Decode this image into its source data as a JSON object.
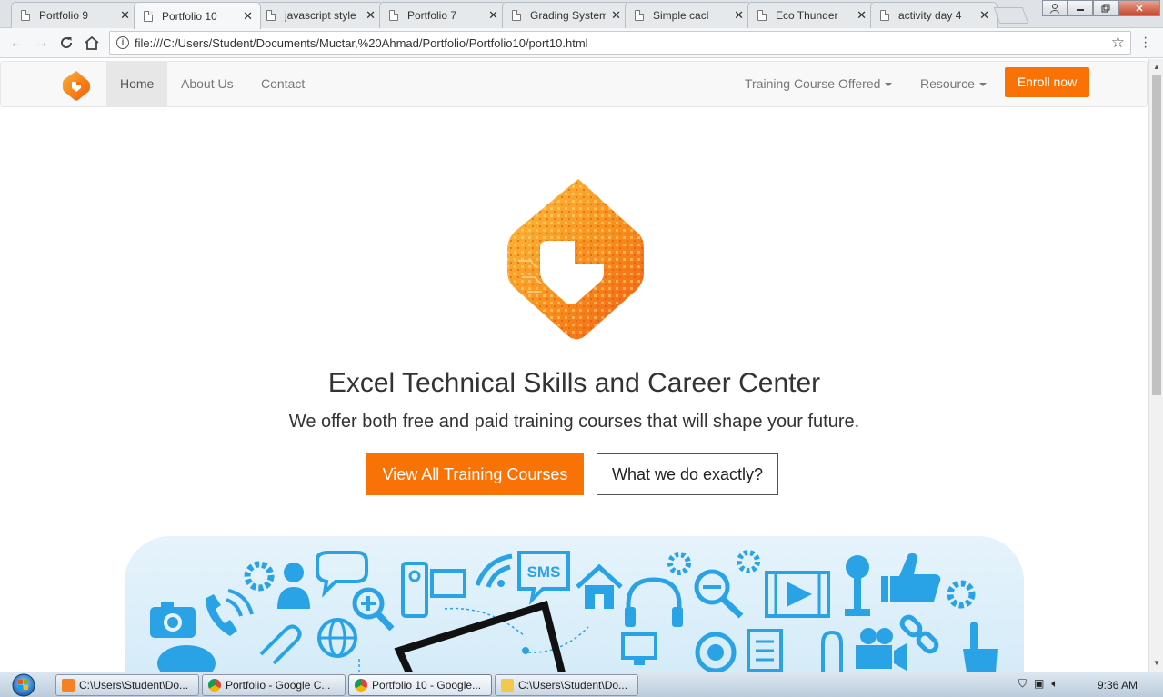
{
  "browser": {
    "tabs": [
      {
        "title": "Portfolio 9",
        "active": false
      },
      {
        "title": "Portfolio 10",
        "active": true
      },
      {
        "title": "javascript style",
        "active": false
      },
      {
        "title": "Portfolio 7",
        "active": false
      },
      {
        "title": "Grading System",
        "active": false
      },
      {
        "title": "Simple cacl",
        "active": false
      },
      {
        "title": "Eco Thunder",
        "active": false
      },
      {
        "title": "activity day 4",
        "active": false
      }
    ],
    "url": "file:///C:/Users/Student/Documents/Muctar,%20Ahmad/Portfolio/Portfolio10/port10.html"
  },
  "site": {
    "nav": {
      "home": "Home",
      "about": "About Us",
      "contact": "Contact",
      "training": "Training Course Offered",
      "resource": "Resource",
      "enroll": "Enroll now"
    },
    "hero": {
      "title": "Excel Technical Skills and Career Center",
      "subtitle": "We offer both free and paid training courses that will shape your future.",
      "primary_button": "View All Training Courses",
      "secondary_button": "What we do exactly?",
      "sms_label": "SMS"
    },
    "colors": {
      "accent": "#f97205",
      "illustration_blue": "#2aa3e6"
    }
  },
  "taskbar": {
    "items": [
      {
        "label": "C:\\Users\\Student\\Do...",
        "icon": "sublime-text-icon"
      },
      {
        "label": "Portfolio - Google C...",
        "icon": "chrome-icon"
      },
      {
        "label": "Portfolio 10 - Google...",
        "icon": "chrome-icon"
      },
      {
        "label": "C:\\Users\\Student\\Do...",
        "icon": "folder-icon"
      }
    ],
    "clock": "9:36 AM"
  }
}
